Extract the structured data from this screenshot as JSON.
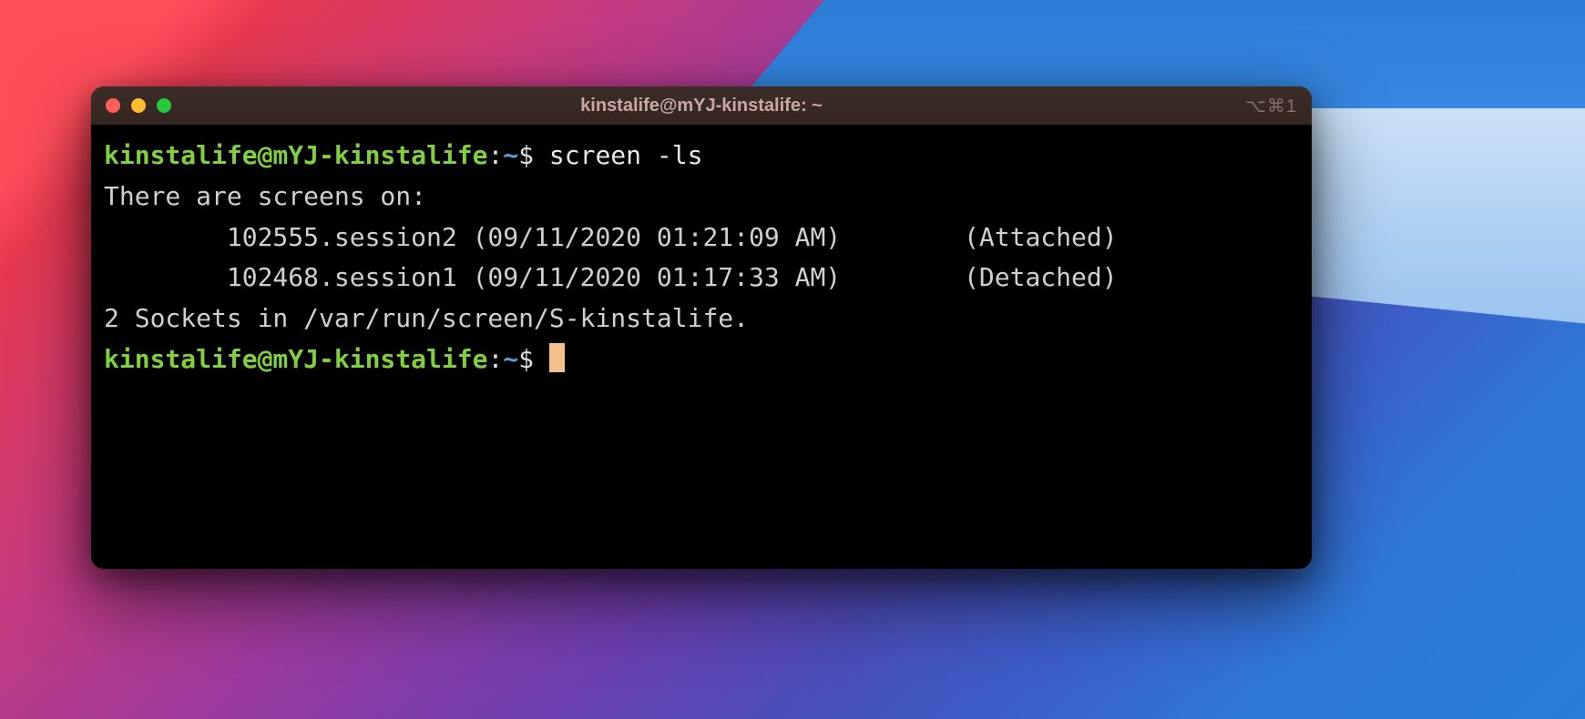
{
  "window": {
    "title": "kinstalife@mYJ-kinstalife: ~",
    "shortcut_hint": "⌥⌘1"
  },
  "prompt": {
    "user_host": "kinstalife@mYJ-kinstalife",
    "separator": ":",
    "path": "~",
    "symbol": "$"
  },
  "lines": [
    {
      "type": "prompt",
      "command": "screen -ls"
    },
    {
      "type": "output",
      "text": "There are screens on:"
    },
    {
      "type": "output",
      "text": "        102555.session2 (09/11/2020 01:21:09 AM)        (Attached)"
    },
    {
      "type": "output",
      "text": "        102468.session1 (09/11/2020 01:17:33 AM)        (Detached)"
    },
    {
      "type": "output",
      "text": "2 Sockets in /var/run/screen/S-kinstalife."
    },
    {
      "type": "prompt",
      "command": "",
      "cursor": true
    }
  ]
}
